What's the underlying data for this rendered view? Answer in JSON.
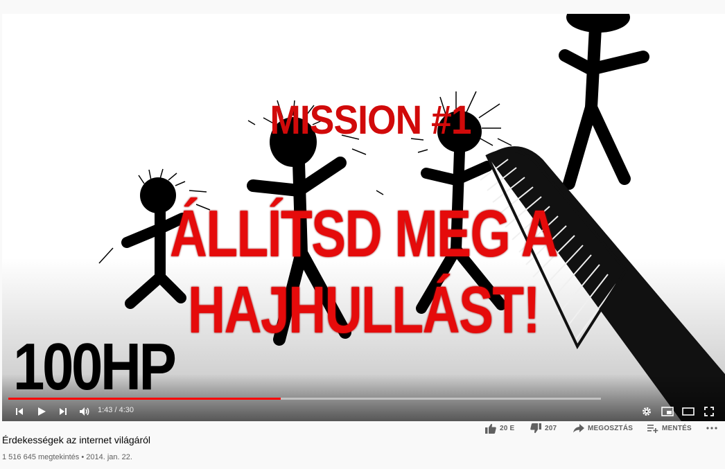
{
  "thumbnail": {
    "mission_text": "MISSION #1",
    "headline_text": "ÁLLÍTSD MEG A HAJHULLÁST!",
    "hp_text": "100HP"
  },
  "player": {
    "time_display": "1:43 / 4:30",
    "progress_fraction": 0.46,
    "accent_color": "#ff0000"
  },
  "video": {
    "title": "Érdekességek az internet világáról",
    "meta": "1 516 645 megtekintés • 2014. jan. 22."
  },
  "actions": {
    "like_count": "20 E",
    "dislike_count": "207",
    "share_label": "MEGOSZTÁS",
    "save_label": "MENTÉS"
  },
  "icons": {
    "like": "thumbs-up-icon",
    "dislike": "thumbs-down-icon",
    "share": "share-arrow-icon",
    "save": "playlist-add-icon",
    "more": "more-horizontal-icon"
  }
}
